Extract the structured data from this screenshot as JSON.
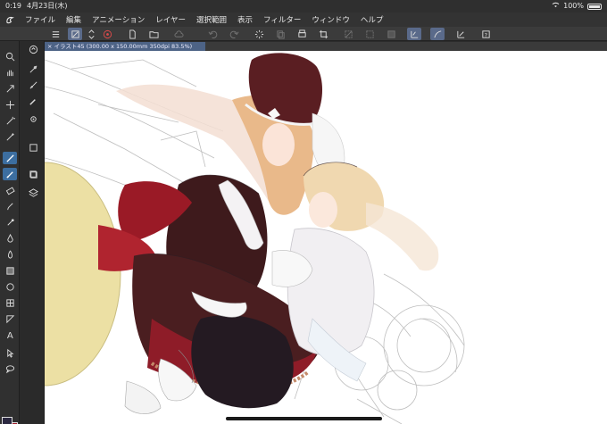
{
  "status": {
    "time": "0:19",
    "date": "4月23日(木)",
    "battery": "100%"
  },
  "menu": [
    "ファイル",
    "編集",
    "アニメーション",
    "レイヤー",
    "選択範囲",
    "表示",
    "フィルター",
    "ウィンドウ",
    "ヘルプ"
  ],
  "canvas_tab": {
    "title": "イラスト45 (300.00 x 150.00mm 350dpi 83.5%)"
  },
  "colors": {
    "main": "#2b2840",
    "sub": "#a11a2a",
    "accent": "#4d6386"
  },
  "toolbar_icons": [
    "menu-icon",
    "stroke-icon",
    "stroke-toggle-icon",
    "eye-icon",
    "new-icon",
    "open-icon",
    "cloud-icon",
    "undo-icon",
    "redo-icon",
    "loading-icon",
    "copy-icon",
    "print-icon",
    "crop-icon",
    "deselect-icon",
    "select-all-icon",
    "fill-icon",
    "ruler-icon",
    "snap-icon",
    "snap-check-icon",
    "help-icon"
  ],
  "tools": [
    "zoom-icon",
    "hand-icon",
    "rotate-icon",
    "eyedropper-icon",
    "move-icon",
    "magic-wand-icon",
    "eyedropper2-icon",
    "pen-icon",
    "pencil-icon",
    "brush-icon",
    "eraser-icon",
    "airbrush-icon",
    "blend-icon",
    "fill-bucket-icon",
    "gradient-icon",
    "figure-icon",
    "frame-icon",
    "ruler-tool-icon",
    "text-icon",
    "operation-icon",
    "balloon-icon",
    "lasso-icon"
  ]
}
